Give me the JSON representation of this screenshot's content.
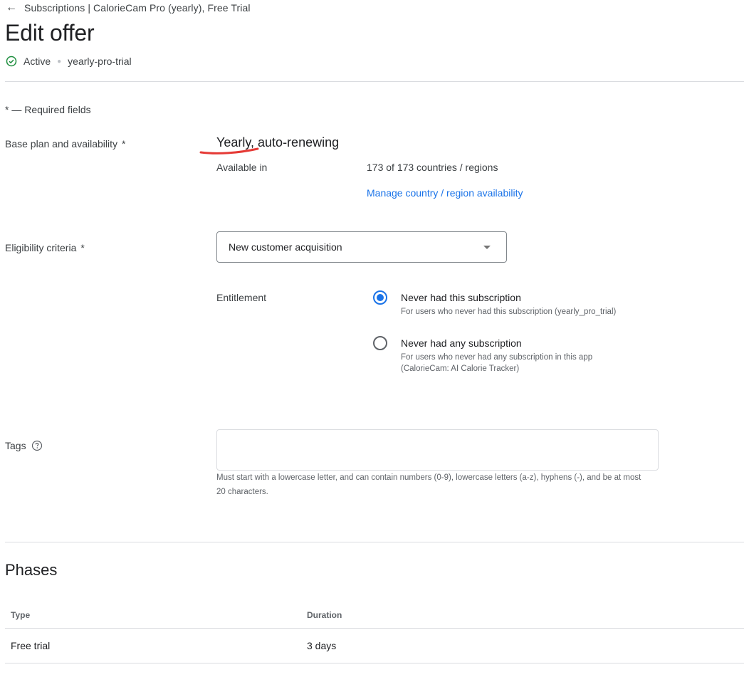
{
  "breadcrumb": {
    "text": "Subscriptions | CalorieCam Pro (yearly), Free Trial"
  },
  "header": {
    "title": "Edit offer",
    "status": "Active",
    "offer_id": "yearly-pro-trial"
  },
  "form": {
    "required_note": "* — Required fields",
    "base_plan": {
      "label": "Base plan and availability",
      "value": "Yearly, auto-renewing",
      "available_label": "Available in",
      "available_value": "173 of 173 countries / regions",
      "manage_link": "Manage country / region availability"
    },
    "eligibility": {
      "label": "Eligibility criteria",
      "selected": "New customer acquisition",
      "entitlement_label": "Entitlement",
      "options": [
        {
          "title": "Never had this subscription",
          "desc": "For users who never had this subscription (yearly_pro_trial)",
          "checked": true
        },
        {
          "title": "Never had any subscription",
          "desc": "For users who never had any subscription in this app (CalorieCam: AI Calorie Tracker)",
          "checked": false
        }
      ]
    },
    "tags": {
      "label": "Tags",
      "value": "",
      "hint": "Must start with a lowercase letter, and can contain numbers (0-9), lowercase letters (a-z), hyphens (-), and be at most 20 characters."
    },
    "required_star": "*"
  },
  "phases": {
    "title": "Phases",
    "columns": [
      "Type",
      "Duration"
    ],
    "rows": [
      [
        "Free trial",
        "3 days"
      ]
    ]
  },
  "colors": {
    "accent": "#1a73e8",
    "success": "#1e8e3e",
    "annotation": "#e53935"
  }
}
